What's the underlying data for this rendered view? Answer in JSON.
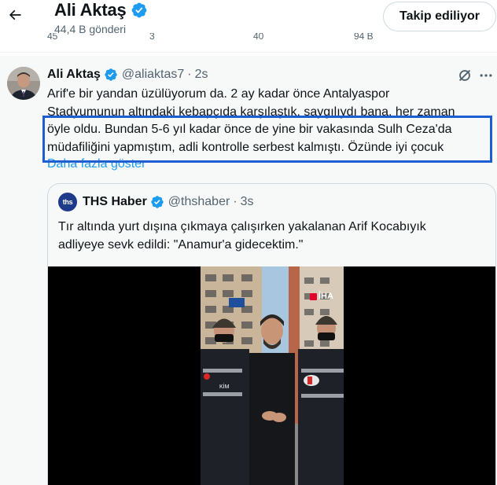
{
  "header": {
    "profile_name": "Ali Aktaş",
    "post_count": "44,4 B gönderi",
    "follow_label": "Takip ediliyor",
    "partial_stats": [
      "45",
      "3",
      "40",
      "94 B"
    ]
  },
  "tweet": {
    "author": "Ali Aktaş",
    "handle": "@aliaktas7",
    "separator": "·",
    "time": "2s",
    "lines": [
      "Arif'e bir yandan üzülüyorum da. 2 ay kadar önce Antalyaspor",
      "Stadyumunun altındaki kebapçıda karşılaştık, saygılıydı bana, her zaman",
      "öyle oldu. Bundan 5-6 yıl kadar önce de yine bir vakasında Sulh Ceza'da",
      "müdafiliğini yapmıştım, adli kontrolle serbest kalmıştı. Özünde iyi çocuk"
    ],
    "show_more": "Daha fazla göster"
  },
  "quote": {
    "avatar_text": "ths",
    "author": "THS Haber",
    "handle": "@thshaber",
    "separator": "·",
    "time": "3s",
    "text": "Tır altında yurt dışına çıkmaya çalışırken yakalanan Arif Kocabıyık adliyeye sevk edildi: \"Anamur'a gidecektim.\"",
    "media_watermark": "İHA",
    "vest_text": "KİM"
  },
  "colors": {
    "accent_blue": "#1d9bf0",
    "verified_blue": "#1d9bf0",
    "highlight_box": "#1d5fd3",
    "text_primary": "#0f1419",
    "text_secondary": "#536471"
  },
  "icons": {
    "back": "arrow-left-icon",
    "verified": "verified-badge-icon",
    "grok": "grok-icon",
    "more": "more-horizontal-icon"
  }
}
